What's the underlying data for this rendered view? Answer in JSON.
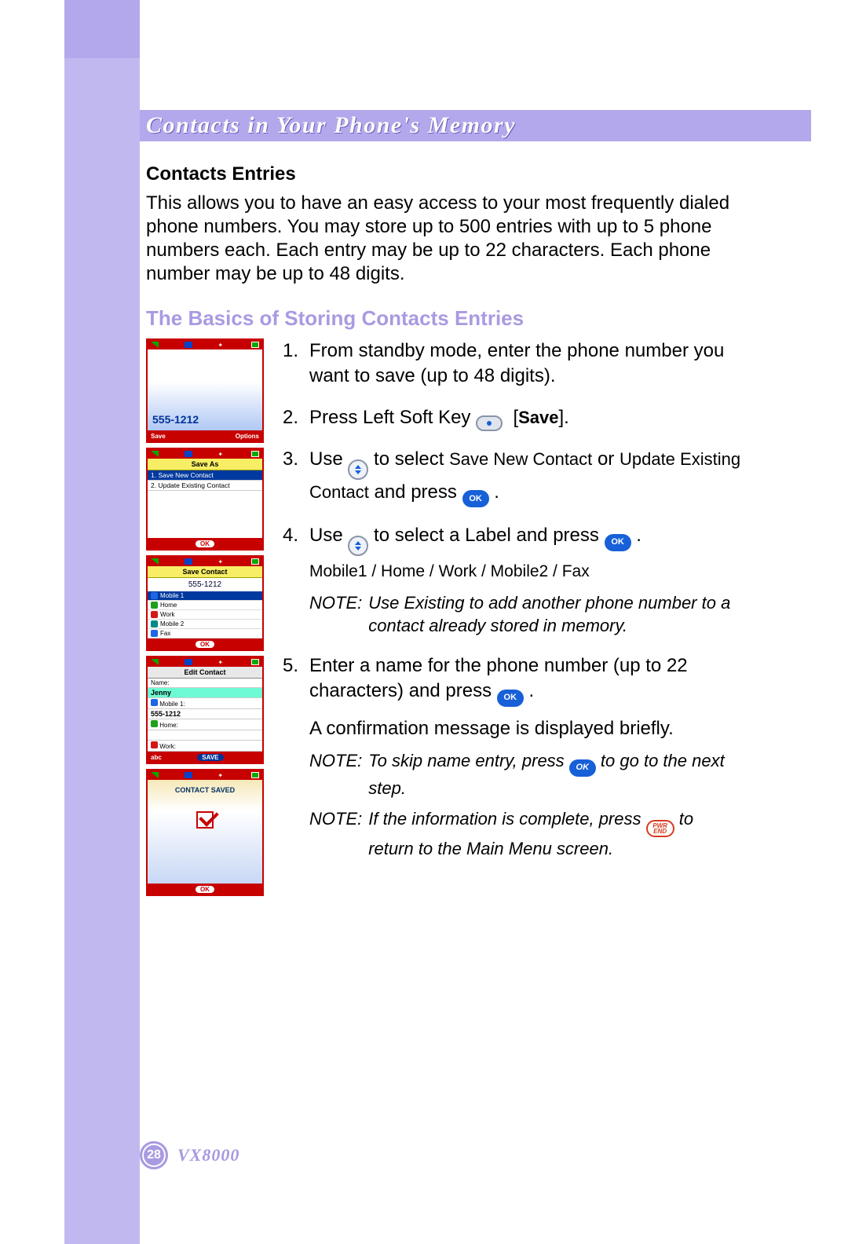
{
  "header": {
    "title": "Contacts in Your Phone's Memory"
  },
  "section": {
    "heading": "Contacts Entries",
    "body": "This allows you to have an easy access to your most frequently dialed phone numbers. You may store up to 500 entries with up to 5 phone numbers each. Each entry may be up to 22 characters. Each phone number may be up to 48 digits."
  },
  "subsection": {
    "heading": "The Basics of Storing Contacts Entries"
  },
  "screens": {
    "dial": {
      "number": "555-1212",
      "softleft": "Save",
      "softright": "Options"
    },
    "saveas": {
      "title": "Save As",
      "items": [
        "1. Save New Contact",
        "2. Update Existing Contact"
      ],
      "ok": "OK"
    },
    "savecontact": {
      "title": "Save Contact",
      "number": "555-1212",
      "labels": [
        {
          "name": "Mobile 1",
          "cls": "lb-blue",
          "hi": true
        },
        {
          "name": "Home",
          "cls": "lb-green",
          "hi": false
        },
        {
          "name": "Work",
          "cls": "lb-red",
          "hi": false
        },
        {
          "name": "Mobile 2",
          "cls": "lb-teal",
          "hi": false
        },
        {
          "name": "Fax",
          "cls": "lb-blue",
          "hi": false
        }
      ],
      "ok": "OK"
    },
    "edit": {
      "title": "Edit Contact",
      "name_label": "Name:",
      "name_value": "Jenny",
      "mobile1_label": "Mobile 1:",
      "mobile1_value": "555-1212",
      "home_label": "Home:",
      "work_label": "Work:",
      "softleft": "abc",
      "softcenter": "SAVE"
    },
    "saved": {
      "message": "CONTACT SAVED",
      "ok": "OK"
    }
  },
  "steps": {
    "s1": {
      "n": "1.",
      "text": "From standby mode, enter the phone number you want to save (up to 48 digits)."
    },
    "s2": {
      "n": "2.",
      "pre": "Press Left Soft Key ",
      "save_label": "Save"
    },
    "s3": {
      "n": "3.",
      "pre": "Use ",
      "mid": " to select ",
      "opt1": "Save New Contact",
      "or": " or ",
      "opt2": "Update Existing Contact",
      "post": " and press "
    },
    "s4": {
      "n": "4.",
      "pre": "Use ",
      "mid": " to select a Label and press ",
      "labels": "Mobile1 / Home / Work / Mobile2 / Fax",
      "note_label": "NOTE:",
      "note": "Use Existing to add another phone number to a contact already stored in memory."
    },
    "s5": {
      "n": "5.",
      "pre": "Enter a name for the phone number (up to 22 characters) and press ",
      "confirm": "A confirmation message is displayed briefly.",
      "note1_label": "NOTE:",
      "note1_pre": "To skip name entry, press ",
      "note1_post": " to go to the next step.",
      "note2_label": "NOTE:",
      "note2_pre": "If the information is complete, press ",
      "note2_post": " to return to the Main Menu screen."
    }
  },
  "keys": {
    "ok": "OK",
    "end_top": "PWR",
    "end_bot": "END"
  },
  "footer": {
    "page": "28",
    "model": "VX8000"
  }
}
